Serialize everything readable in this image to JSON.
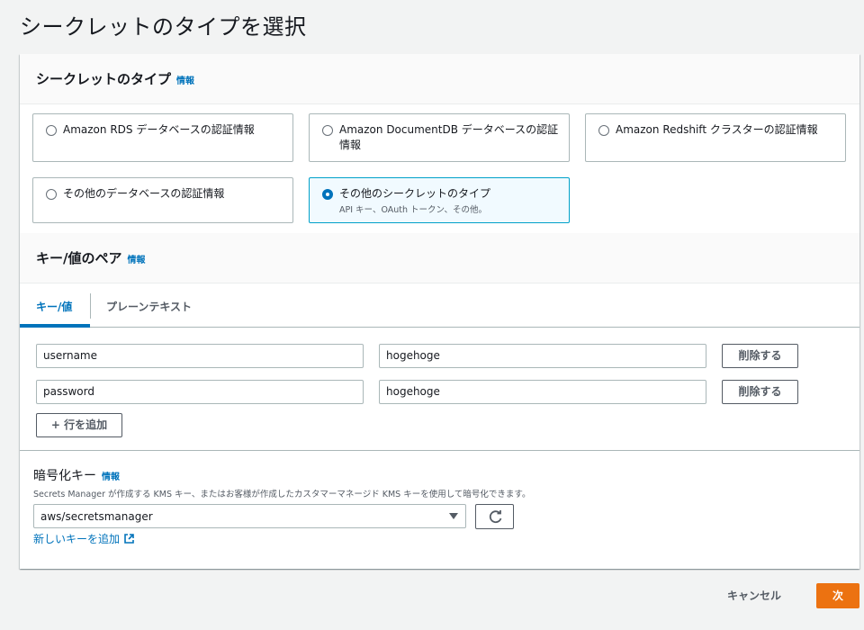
{
  "page": {
    "title": "シークレットのタイプを選択"
  },
  "secret_type": {
    "title": "シークレットのタイプ",
    "info": "情報",
    "options": [
      {
        "label": "Amazon RDS データベースの認証情報",
        "selected": false
      },
      {
        "label": "Amazon DocumentDB データベースの認証情報",
        "selected": false
      },
      {
        "label": "Amazon Redshift クラスターの認証情報",
        "selected": false
      },
      {
        "label": "その他のデータベースの認証情報",
        "selected": false
      },
      {
        "label": "その他のシークレットのタイプ",
        "description": "API キー、OAuth トークン、その他。",
        "selected": true
      }
    ]
  },
  "kv_pairs": {
    "title": "キー/値のペア",
    "info": "情報",
    "tabs": [
      {
        "label": "キー/値",
        "active": true
      },
      {
        "label": "プレーンテキスト",
        "active": false
      }
    ],
    "rows": [
      {
        "key": "username",
        "value": "hogehoge",
        "delete_label": "削除する"
      },
      {
        "key": "password",
        "value": "hogehoge",
        "delete_label": "削除する"
      }
    ],
    "add_row_label": "+ 行を追加"
  },
  "encryption": {
    "title": "暗号化キー",
    "info": "情報",
    "description": "Secrets Manager が作成する KMS キー、またはお客様が作成したカスタマーマネージド KMS キーを使用して暗号化できます。",
    "selected_key": "aws/secretsmanager",
    "add_key_link": "新しいキーを追加"
  },
  "footer": {
    "cancel_label": "キャンセル",
    "next_label": "次"
  },
  "colors": {
    "accent": "#0073bb",
    "primary_button": "#ec7211",
    "selected_tile_bg": "#f1faff"
  },
  "icons": {
    "refresh": "refresh-icon",
    "external_link": "external-link-icon",
    "dropdown": "caret-down-icon"
  }
}
